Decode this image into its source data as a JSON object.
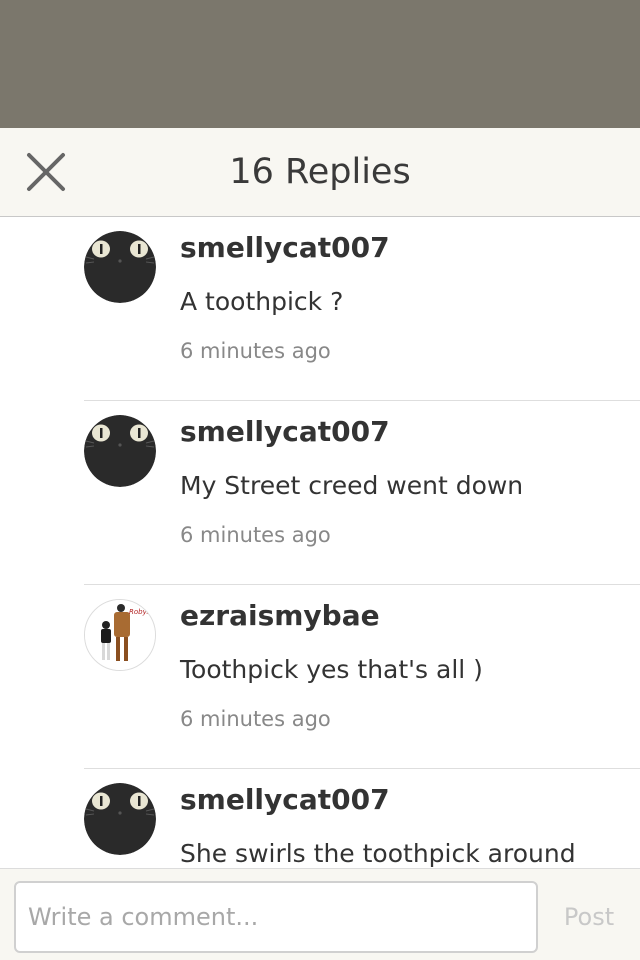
{
  "header": {
    "title": "16 Replies",
    "close_icon": "close-icon"
  },
  "replies": [
    {
      "username": "smellycat007",
      "text": "A toothpick ?",
      "time": "6 minutes ago",
      "avatar": "black-cat-avatar"
    },
    {
      "username": "smellycat007",
      "text": "My Street creed went down",
      "time": "6 minutes ago",
      "avatar": "black-cat-avatar"
    },
    {
      "username": "ezraismybae",
      "text": "Toothpick yes that's all )",
      "time": "6 minutes ago",
      "avatar": "illustrated-couple-avatar",
      "avatar_caption": "Roby."
    },
    {
      "username": "smellycat007",
      "text": "She swirls the toothpick around",
      "time": "",
      "avatar": "black-cat-avatar"
    }
  ],
  "composer": {
    "placeholder": "Write a comment...",
    "value": "",
    "post_label": "Post"
  },
  "colors": {
    "backdrop": "#7b776c",
    "header_bg": "#f8f7f2",
    "post_disabled": "#c8c8c8"
  }
}
